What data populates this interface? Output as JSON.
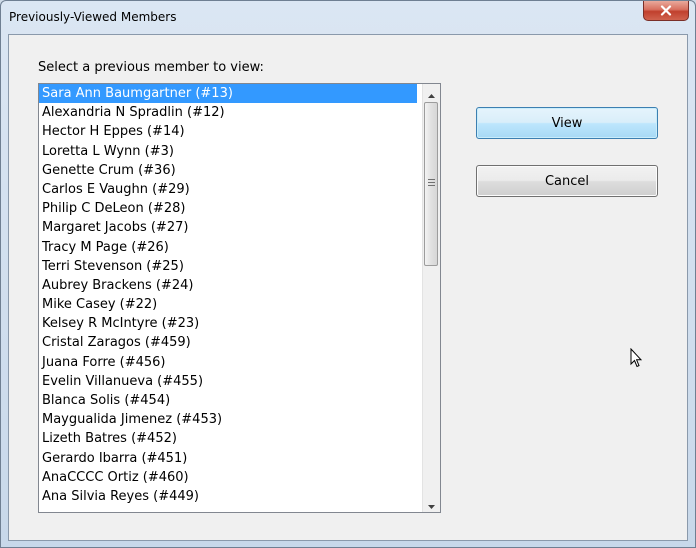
{
  "window": {
    "title": "Previously-Viewed Members"
  },
  "prompt": "Select a previous member to view:",
  "members": [
    "Sara Ann Baumgartner (#13)",
    "Alexandria N Spradlin (#12)",
    "Hector H Eppes (#14)",
    "Loretta L Wynn (#3)",
    "Genette Crum (#36)",
    "Carlos E Vaughn (#29)",
    "Philip C DeLeon (#28)",
    "Margaret Jacobs (#27)",
    "Tracy M Page (#26)",
    "Terri Stevenson (#25)",
    "Aubrey Brackens (#24)",
    "Mike Casey (#22)",
    "Kelsey R McIntyre (#23)",
    "Cristal Zaragos (#459)",
    "Juana Forre (#456)",
    "Evelin Villanueva (#455)",
    "Blanca Solis (#454)",
    "Maygualida Jimenez (#453)",
    "Lizeth Batres (#452)",
    "Gerardo Ibarra (#451)",
    "AnaCCCC Ortiz (#460)",
    "Ana Silvia Reyes (#449)"
  ],
  "selected_index": 0,
  "buttons": {
    "view_label": "View",
    "cancel_label": "Cancel"
  },
  "colors": {
    "selection": "#3399ff",
    "close_button": "#c8432f"
  },
  "icons": {
    "close": "close-icon",
    "scroll_up": "chevron-up-icon",
    "scroll_down": "chevron-down-icon",
    "cursor": "mouse-pointer-icon"
  }
}
